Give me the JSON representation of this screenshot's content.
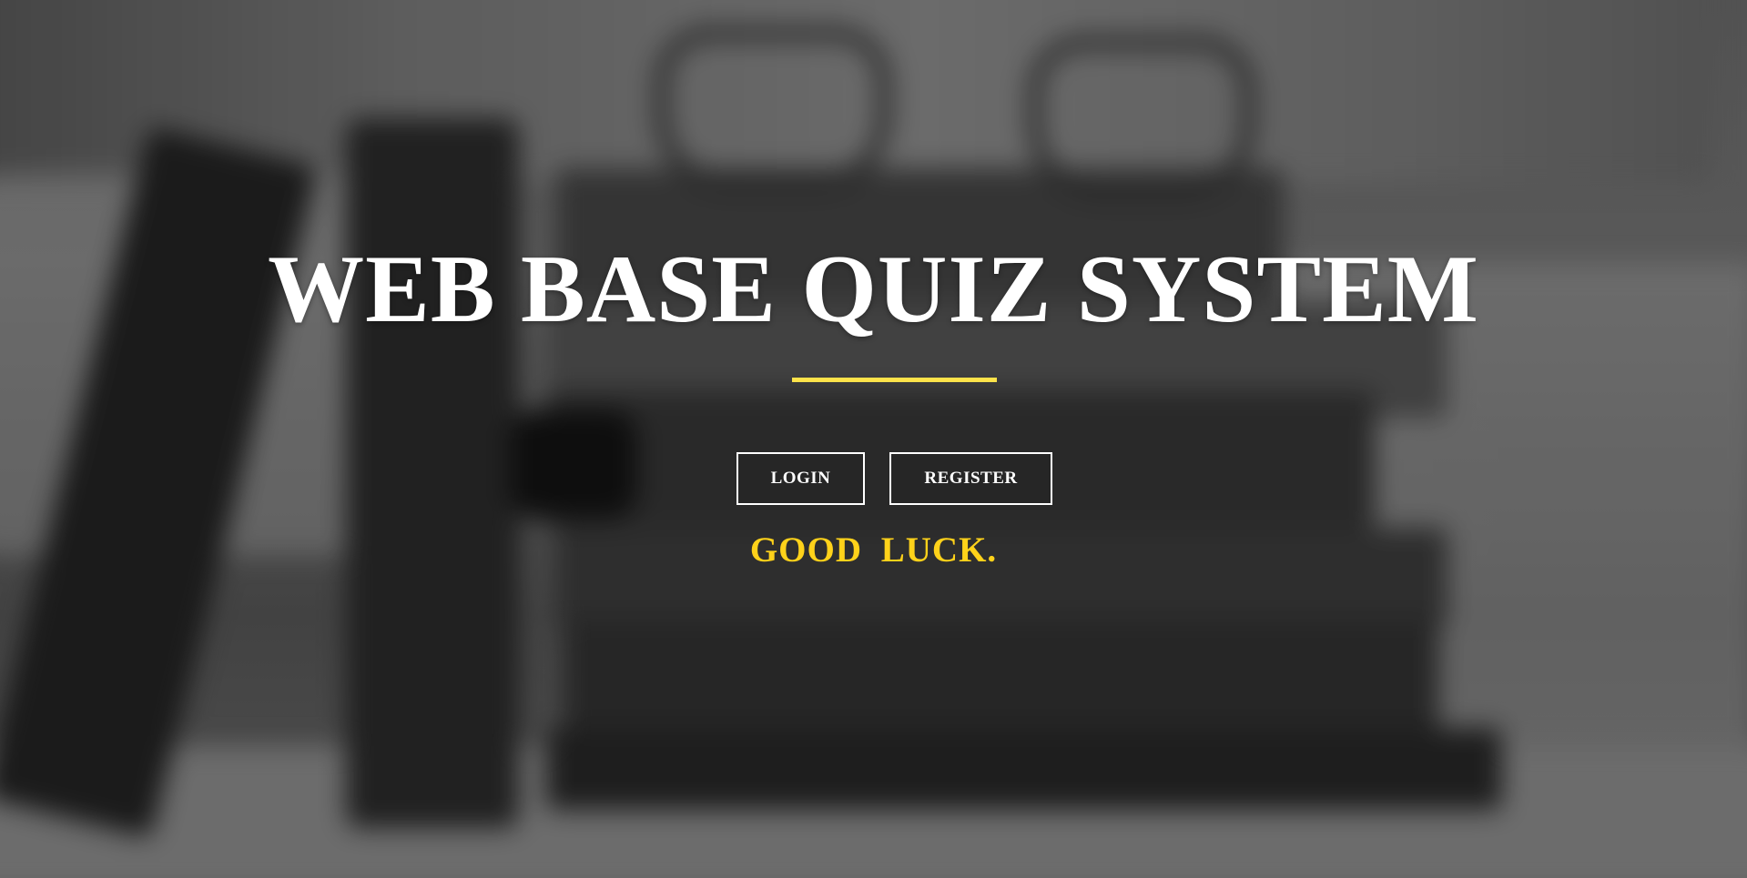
{
  "hero": {
    "title": "WEB BASE QUIZ SYSTEM",
    "tagline": "GOOD  LUCK.",
    "accent_color": "#ffe34a",
    "tagline_color": "#ffd21a",
    "background_image": "blurred-books-and-glasses-photo"
  },
  "actions": {
    "login_label": "LOGIN",
    "register_label": "REGISTER"
  }
}
